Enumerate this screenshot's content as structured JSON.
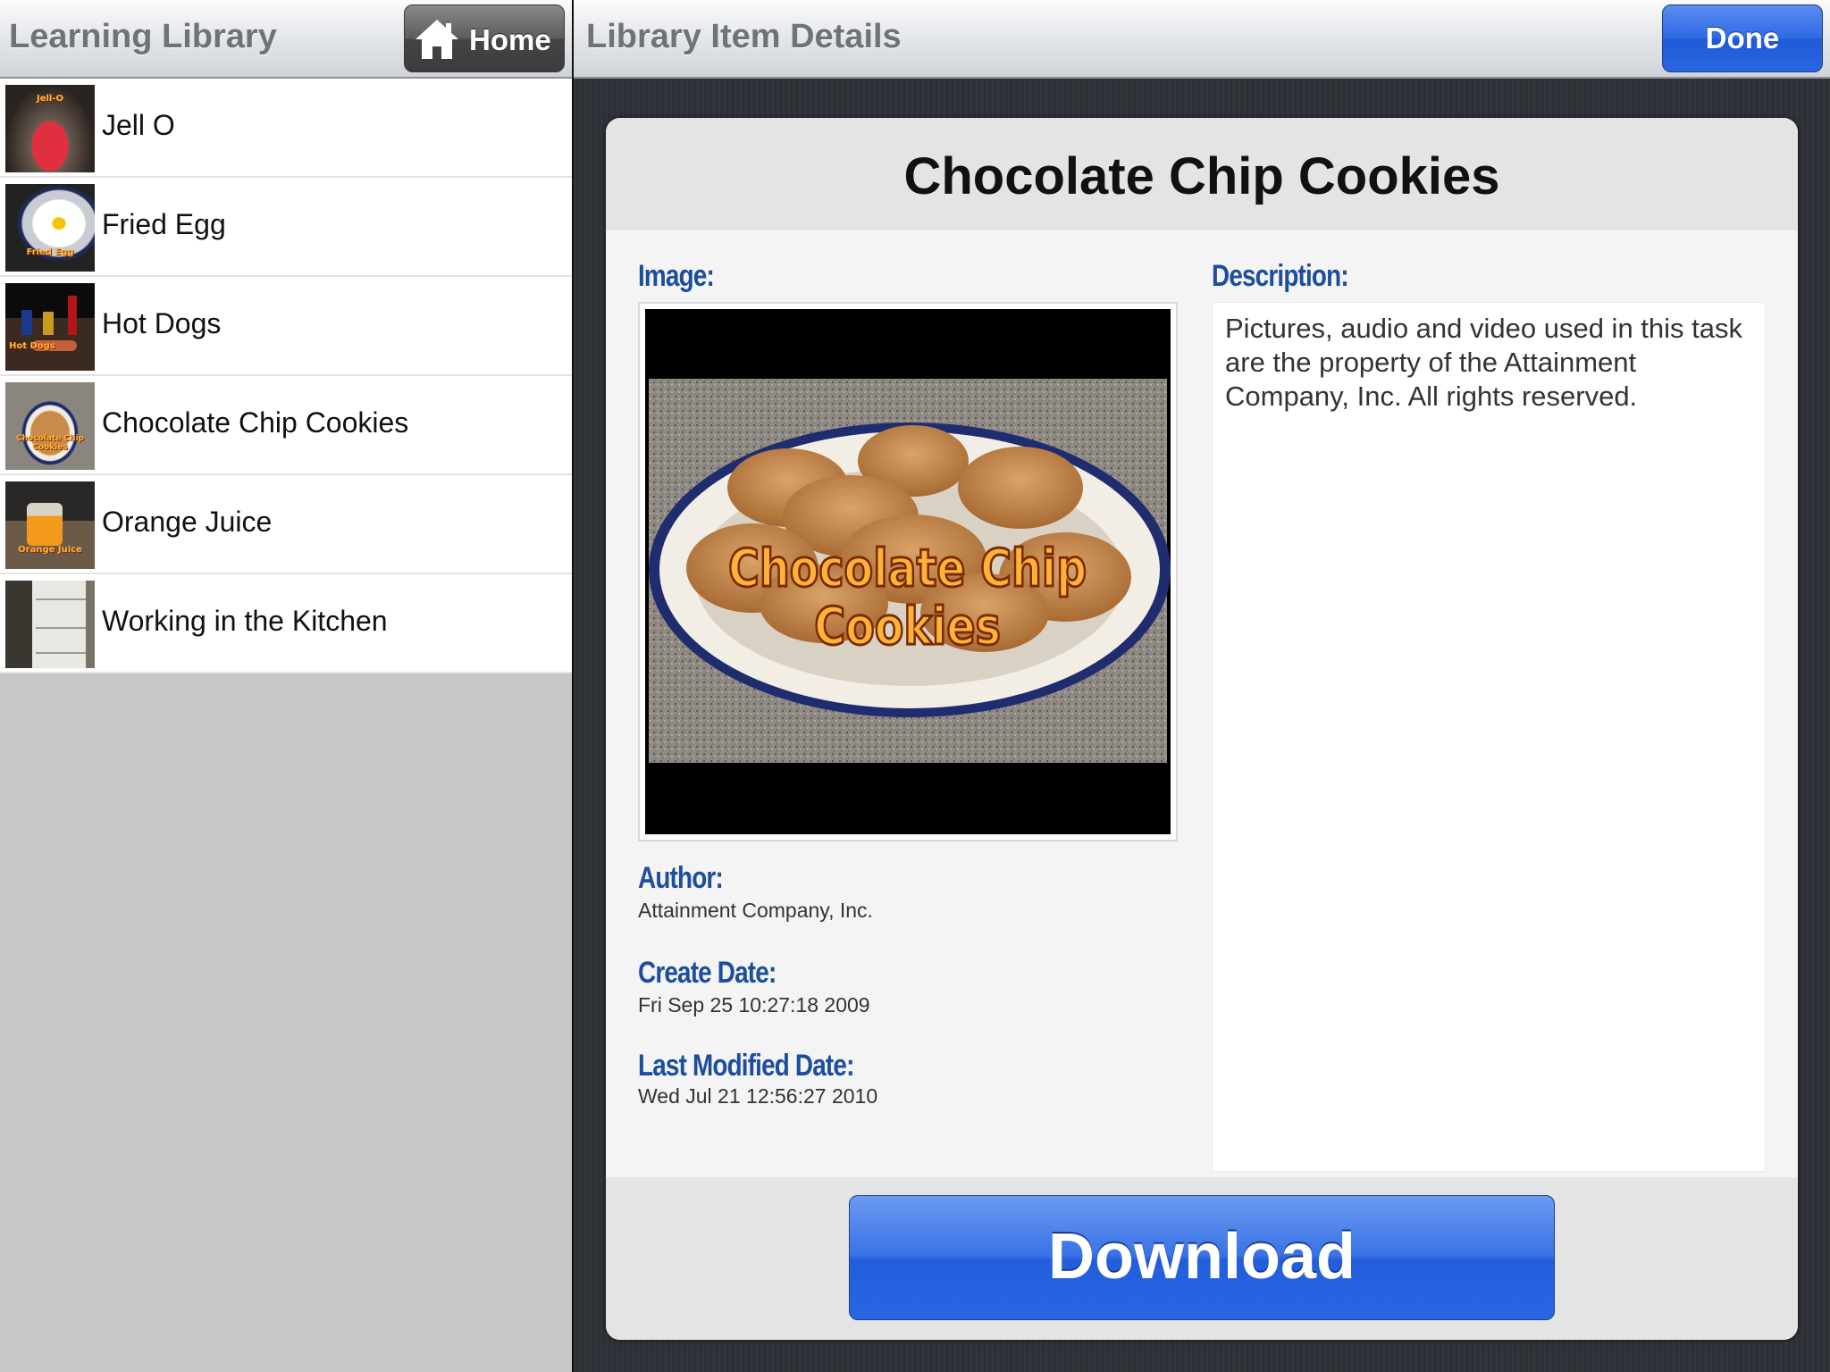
{
  "master": {
    "title": "Learning Library",
    "home_label": "Home",
    "items": [
      {
        "label": "Jell O",
        "thumb_text": "Jell-O"
      },
      {
        "label": "Fried Egg",
        "thumb_text": "Fried Egg"
      },
      {
        "label": "Hot Dogs",
        "thumb_text": "Hot Dogs"
      },
      {
        "label": "Chocolate Chip Cookies",
        "thumb_text": "Chocolate Chip Cookies"
      },
      {
        "label": "Orange Juice",
        "thumb_text": "Orange Juice"
      },
      {
        "label": "Working in the Kitchen",
        "thumb_text": ""
      }
    ]
  },
  "detail": {
    "title": "Library Item Details",
    "done_label": "Done",
    "item_title": "Chocolate Chip Cookies",
    "image_label": "Image:",
    "image_caption_line1": "Chocolate Chip",
    "image_caption_line2": "Cookies",
    "description_label": "Description:",
    "description": "Pictures, audio and video used in this task are the property of the Attainment Company, Inc. All rights reserved.",
    "author_label": "Author:",
    "author": "Attainment Company, Inc.",
    "create_date_label": "Create Date:",
    "create_date": "Fri Sep 25 10:27:18 2009",
    "modified_date_label": "Last Modified Date:",
    "modified_date": "Wed Jul 21 12:56:27 2010",
    "download_label": "Download"
  },
  "colors": {
    "accent_blue": "#2a64e0",
    "label_blue": "#1c4e9c",
    "caption_orange": "#ffb23a"
  }
}
